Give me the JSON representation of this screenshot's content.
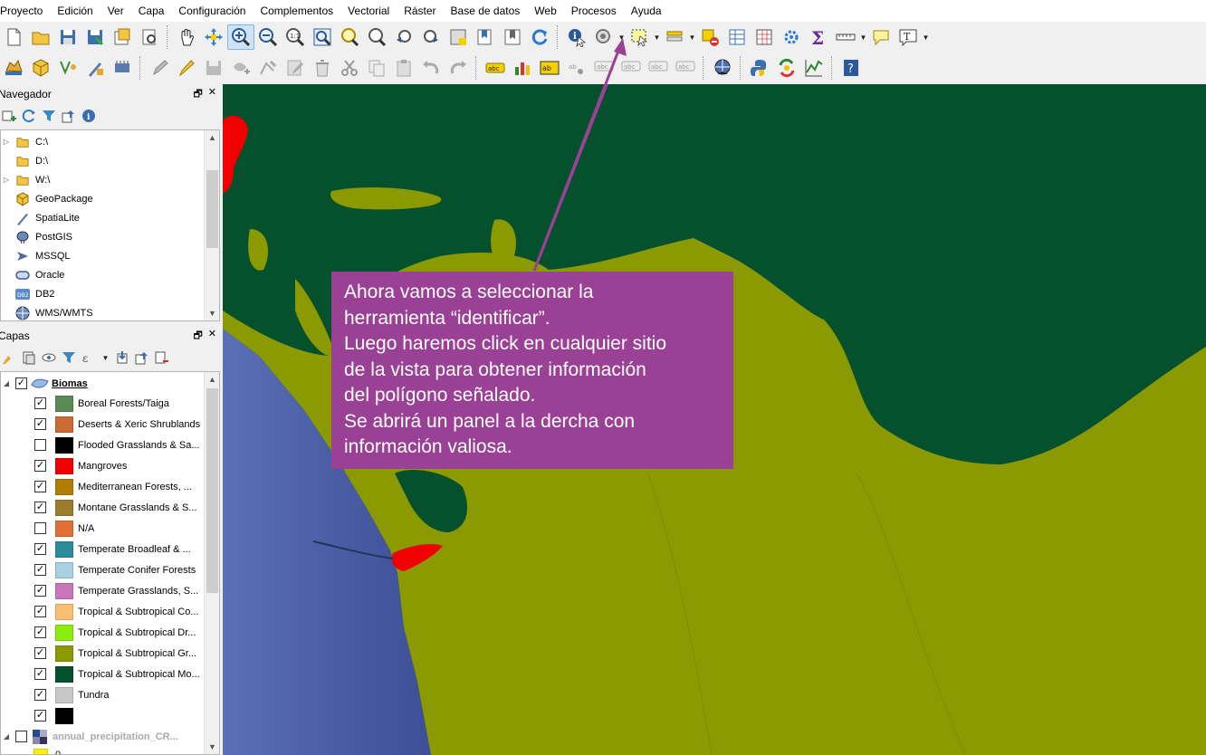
{
  "menu": [
    "Proyecto",
    "Edición",
    "Ver",
    "Capa",
    "Configuración",
    "Complementos",
    "Vectorial",
    "Ráster",
    "Base de datos",
    "Web",
    "Procesos",
    "Ayuda"
  ],
  "navigator": {
    "title": "Navegador",
    "items": [
      {
        "label": "C:\\",
        "icon": "folder-icon",
        "expandable": true
      },
      {
        "label": "D:\\",
        "icon": "folder-icon",
        "expandable": false
      },
      {
        "label": "W:\\",
        "icon": "folder-icon",
        "expandable": true
      },
      {
        "label": "GeoPackage",
        "icon": "geopackage-icon",
        "expandable": false
      },
      {
        "label": "SpatiaLite",
        "icon": "spatialite-icon",
        "expandable": false
      },
      {
        "label": "PostGIS",
        "icon": "postgis-icon",
        "expandable": false
      },
      {
        "label": "MSSQL",
        "icon": "mssql-icon",
        "expandable": false
      },
      {
        "label": "Oracle",
        "icon": "oracle-icon",
        "expandable": false
      },
      {
        "label": "DB2",
        "icon": "db2-icon",
        "expandable": false
      },
      {
        "label": "WMS/WMTS",
        "icon": "wms-icon",
        "expandable": false
      }
    ]
  },
  "layers": {
    "title": "Capas",
    "group": "Biomas",
    "items": [
      {
        "label": "Boreal Forests/Taiga",
        "color": "#5a8a55",
        "checked": true
      },
      {
        "label": "Deserts & Xeric Shrublands",
        "color": "#cc6a32",
        "checked": true
      },
      {
        "label": "Flooded Grasslands & Sa...",
        "color": "#000000",
        "checked": false
      },
      {
        "label": "Mangroves",
        "color": "#f00000",
        "checked": true
      },
      {
        "label": "Mediterranean Forests, ...",
        "color": "#b37d00",
        "checked": true
      },
      {
        "label": "Montane Grasslands & S...",
        "color": "#9a7d2e",
        "checked": true
      },
      {
        "label": "N/A",
        "color": "#e07036",
        "checked": false
      },
      {
        "label": "Temperate Broadleaf & ...",
        "color": "#2d8b9e",
        "checked": true
      },
      {
        "label": "Temperate Conifer Forests",
        "color": "#a9cfe2",
        "checked": true
      },
      {
        "label": "Temperate Grasslands, S...",
        "color": "#c877b8",
        "checked": true
      },
      {
        "label": "Tropical & Subtropical Co...",
        "color": "#fbbf72",
        "checked": true
      },
      {
        "label": "Tropical & Subtropical Dr...",
        "color": "#89ee0c",
        "checked": true
      },
      {
        "label": "Tropical & Subtropical Gr...",
        "color": "#8a9a00",
        "checked": true
      },
      {
        "label": "Tropical & Subtropical Mo...",
        "color": "#06512d",
        "checked": true
      },
      {
        "label": "Tundra",
        "color": "#c8c8c8",
        "checked": true
      },
      {
        "label": "",
        "color": "#000000",
        "checked": true
      }
    ],
    "raster": "annual_precipitation_CR...",
    "raster_first_value": "0"
  },
  "callout": {
    "lines": [
      "Ahora vamos a seleccionar la",
      "herramienta “identificar”.",
      "Luego haremos click en cualquier sitio",
      "de la vista para obtener información",
      "del polígono señalado.",
      "Se abrirá un panel a la dercha con",
      "información valiosa."
    ],
    "color": "#9a4196"
  },
  "colors": {
    "ocean": "#4a5fa8",
    "tropical_moist_forest": "#06512d",
    "tropical_grassland": "#8a9a00",
    "mangroves": "#f00000"
  }
}
